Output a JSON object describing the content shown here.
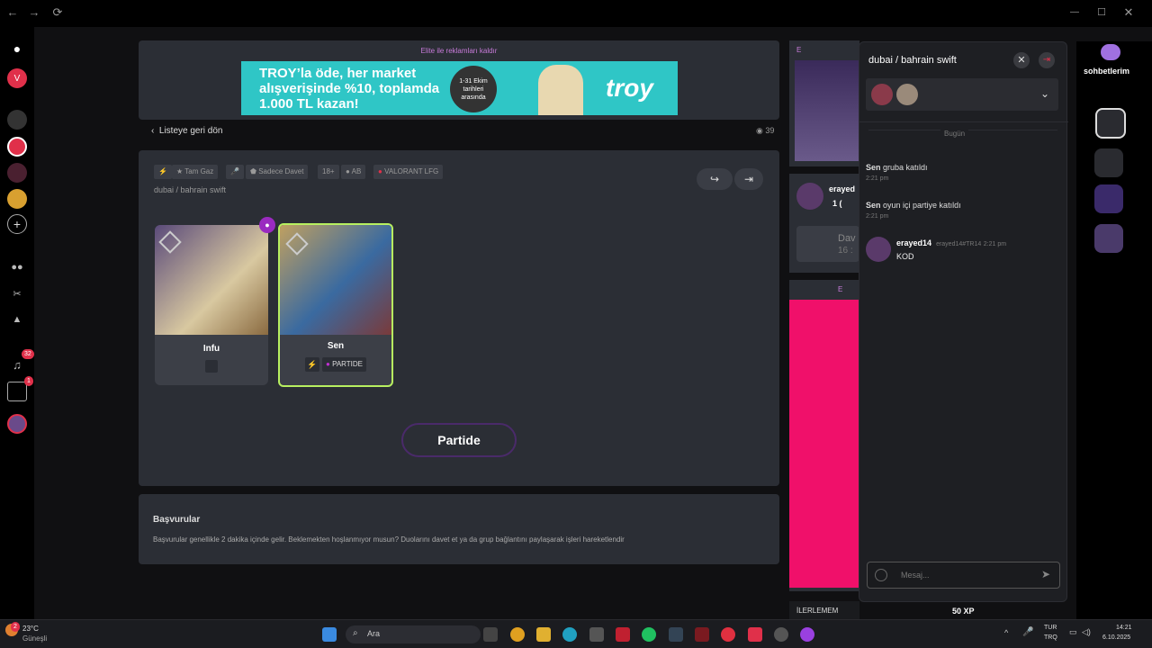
{
  "window": {
    "back": "←",
    "forward": "→",
    "reload": "⟳",
    "minimize": "—",
    "maximize": "☐",
    "close": "✕"
  },
  "ad_banner": {
    "elite_text": "Elite ile reklamları kaldır",
    "headline": "TROY’la öde, her market alışverişinde %10, toplamda 1.000 TL kazan!",
    "date_badge": "1-31 Ekim tarihleri arasında",
    "brand": "troy"
  },
  "nav": {
    "back_label": "Listeye geri dön",
    "view_count": "39"
  },
  "lobby": {
    "tags": [
      "⚡",
      "Tam Gaz",
      "🎤",
      "Sadece Davet",
      "18+",
      "AB",
      "VALORANT LFG"
    ],
    "title": "dubai / bahrain swift",
    "players": [
      {
        "name": "Infu"
      },
      {
        "name": "Sen",
        "status": "PARTIDE"
      }
    ],
    "join_button": "Partide"
  },
  "applications": {
    "title": "Başvurular",
    "text": "Başvurular genellikle 2 dakika içinde gelir. Beklemekten hoşlanmıyor musun? Duolarını davet et ya da grup bağlantını paylaşarak işleri hareketlendir"
  },
  "side": {
    "user": "erayed",
    "likes": "1 (",
    "dav": "Dav",
    "time": "16 :",
    "elite": "E",
    "ilerle": "İLERLEMEM",
    "xp": "50 XP"
  },
  "chat": {
    "title": "dubai / bahrain swift",
    "date": "Bugün",
    "system": [
      {
        "who": "Sen",
        "text": "gruba katıldı",
        "time": "2:21 pm"
      },
      {
        "who": "Sen",
        "text": "oyun içi partiye katıldı",
        "time": "2:21 pm"
      }
    ],
    "message": {
      "name": "erayed14",
      "tag": "erayed14#TR14",
      "time": "2:21 pm",
      "text": "KOD"
    },
    "input_placeholder": "Mesaj..."
  },
  "rightbar": {
    "label": "sohbetlerim"
  },
  "sidebar": {
    "notif_count": "32",
    "friend_count": "1"
  },
  "taskbar": {
    "weather_temp": "23°C",
    "weather_text": "Güneşli",
    "weather_badge": "2",
    "search": "Ara",
    "lang1": "TUR",
    "lang2": "TRQ",
    "time": "14:21",
    "date": "6.10.2025"
  }
}
